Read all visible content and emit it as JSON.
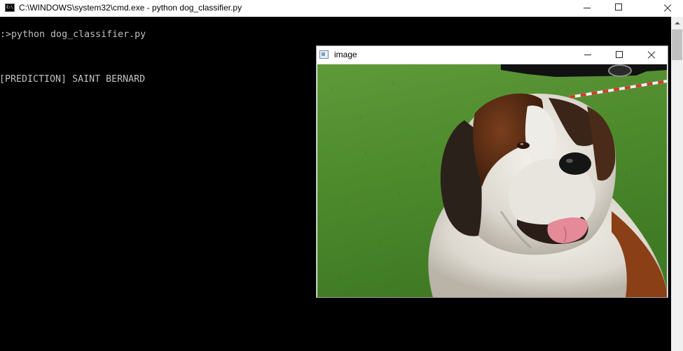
{
  "cmd_window": {
    "title": "C:\\WINDOWS\\system32\\cmd.exe - python  dog_classifier.py",
    "icon": "cmd-icon",
    "icon_text": "C:\\",
    "controls": {
      "minimize": "minimize-icon",
      "maximize": "maximize-icon",
      "close": "close-icon"
    }
  },
  "console": {
    "lines": [
      "D:>python dog_classifier.py",
      "",
      "",
      "",
      "[PREDICTION] SAINT BERNARD"
    ]
  },
  "image_window": {
    "title": "image",
    "icon": "image-window-icon",
    "controls": {
      "minimize": "minimize-icon",
      "maximize": "maximize-icon",
      "close": "close-icon"
    },
    "content": "photo-saint-bernard"
  },
  "colors": {
    "console_bg": "#000000",
    "console_text": "#c0c0c0",
    "titlebar_bg": "#ffffff",
    "grass": "#4f8a2e"
  }
}
